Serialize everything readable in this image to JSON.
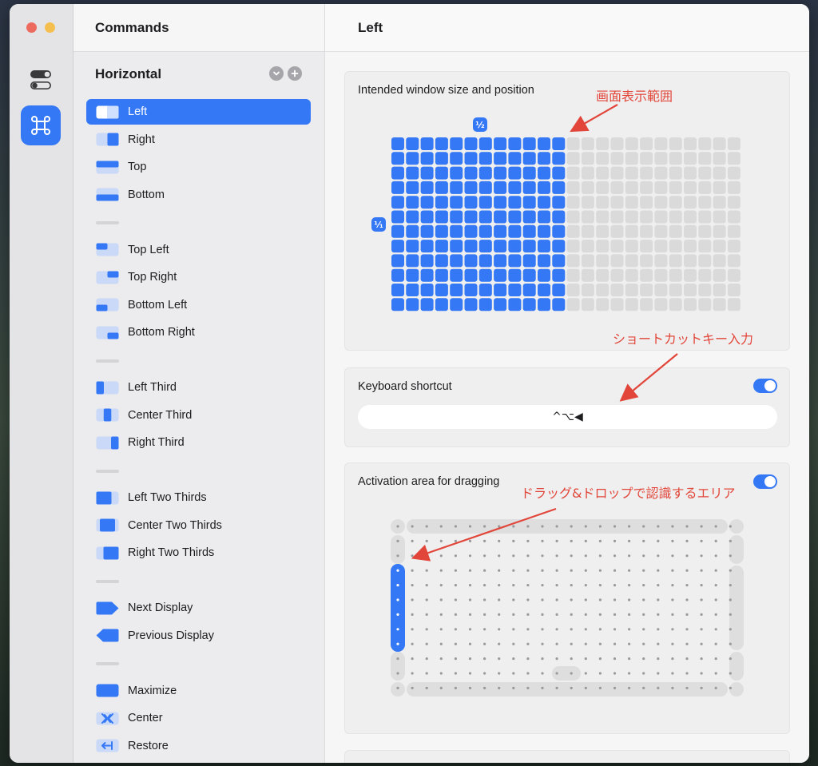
{
  "colors": {
    "accent": "#3478f6",
    "window_bg": "#ffffff",
    "sidebar_bg": "#ececee",
    "grid_empty": "#dadada",
    "annotation": "#e2463a"
  },
  "iconbar": {
    "items": [
      {
        "icon": "toggle-settings-icon"
      },
      {
        "icon": "command-key-icon",
        "selected": true
      }
    ]
  },
  "sidebar": {
    "title": "Commands",
    "section_title": "Horizontal",
    "section_actions": [
      {
        "icon": "chevron-down-circle-icon"
      },
      {
        "icon": "plus-circle-icon"
      }
    ],
    "groups": [
      [
        {
          "label": "Left",
          "icon": "left-half",
          "selected": true
        },
        {
          "label": "Right",
          "icon": "right-half"
        },
        {
          "label": "Top",
          "icon": "top-half"
        },
        {
          "label": "Bottom",
          "icon": "bottom-half"
        }
      ],
      [
        {
          "label": "Top Left",
          "icon": "top-left"
        },
        {
          "label": "Top Right",
          "icon": "top-right"
        },
        {
          "label": "Bottom Left",
          "icon": "bottom-left"
        },
        {
          "label": "Bottom Right",
          "icon": "bottom-right"
        }
      ],
      [
        {
          "label": "Left Third",
          "icon": "left-third"
        },
        {
          "label": "Center Third",
          "icon": "center-third"
        },
        {
          "label": "Right Third",
          "icon": "right-third"
        }
      ],
      [
        {
          "label": "Left Two Thirds",
          "icon": "left-two-thirds"
        },
        {
          "label": "Center Two Thirds",
          "icon": "center-two-thirds"
        },
        {
          "label": "Right Two Thirds",
          "icon": "right-two-thirds"
        }
      ],
      [
        {
          "label": "Next Display",
          "icon": "next-display"
        },
        {
          "label": "Previous Display",
          "icon": "previous-display"
        }
      ],
      [
        {
          "label": "Maximize",
          "icon": "maximize"
        },
        {
          "label": "Center",
          "icon": "center"
        },
        {
          "label": "Restore",
          "icon": "restore"
        }
      ]
    ]
  },
  "main": {
    "title": "Left",
    "size_card": {
      "title": "Intended window size and position",
      "width_label": "½",
      "height_label": "⅟₁",
      "grid_columns": 24,
      "grid_rows": 12,
      "filled_columns": 12
    },
    "shortcut_card": {
      "title": "Keyboard shortcut",
      "enabled": true,
      "value": "^⌥◀"
    },
    "drag_card": {
      "title": "Activation area for dragging",
      "enabled": true,
      "active_edge": "left"
    }
  },
  "annotations": [
    {
      "text": "画面表示範囲"
    },
    {
      "text": "ショートカットキー入力"
    },
    {
      "text": "ドラッグ&ドロップで認識するエリア"
    }
  ]
}
